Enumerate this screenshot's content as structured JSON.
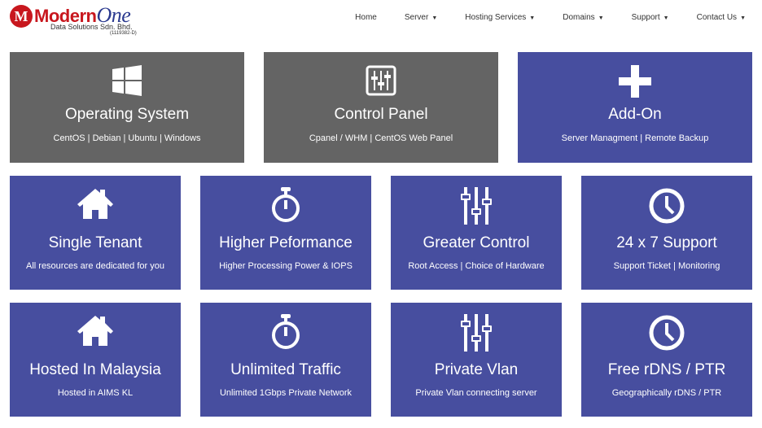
{
  "logo": {
    "mark": "M",
    "brand": "Modern",
    "brand2": "One",
    "company": "Data Solutions Sdn. Bhd.",
    "reg": "(1119382-D)"
  },
  "nav": [
    {
      "label": "Home",
      "dropdown": false
    },
    {
      "label": "Server",
      "dropdown": true
    },
    {
      "label": "Hosting Services",
      "dropdown": true
    },
    {
      "label": "Domains",
      "dropdown": true
    },
    {
      "label": "Support",
      "dropdown": true
    },
    {
      "label": "Contact Us",
      "dropdown": true
    }
  ],
  "colors": {
    "gray": "#646464",
    "blue": "#474e9f",
    "logo_red": "#c8171e"
  },
  "tiles": [
    {
      "title": "Operating System",
      "subtitle": "CentOS | Debian | Ubuntu | Windows",
      "icon": "windows-icon",
      "color": "gray"
    },
    {
      "title": "Control Panel",
      "subtitle": "Cpanel / WHM | CentOS Web Panel",
      "icon": "sliders-square-icon",
      "color": "gray"
    },
    {
      "title": "Add-On",
      "subtitle": "Server Managment | Remote Backup",
      "icon": "plus-icon",
      "color": "blue"
    },
    {
      "title": "Single Tenant",
      "subtitle": "All resources are dedicated for you",
      "icon": "home-icon",
      "color": "blue"
    },
    {
      "title": "Higher Peformance",
      "subtitle": "Higher Processing Power & IOPS",
      "icon": "stopwatch-icon",
      "color": "blue"
    },
    {
      "title": "Greater Control",
      "subtitle": "Root Access | Choice of Hardware",
      "icon": "sliders-icon",
      "color": "blue"
    },
    {
      "title": "24 x 7 Support",
      "subtitle": "Support Ticket | Monitoring",
      "icon": "clock-icon",
      "color": "blue"
    },
    {
      "title": "Hosted In Malaysia",
      "subtitle": "Hosted in AIMS KL",
      "icon": "home-icon",
      "color": "blue"
    },
    {
      "title": "Unlimited Traffic",
      "subtitle": "Unlimited 1Gbps Private Network",
      "icon": "stopwatch-icon",
      "color": "blue"
    },
    {
      "title": "Private Vlan",
      "subtitle": "Private Vlan connecting server",
      "icon": "sliders-icon",
      "color": "blue"
    },
    {
      "title": "Free rDNS / PTR",
      "subtitle": "Geographically rDNS / PTR",
      "icon": "clock-icon",
      "color": "blue"
    }
  ]
}
